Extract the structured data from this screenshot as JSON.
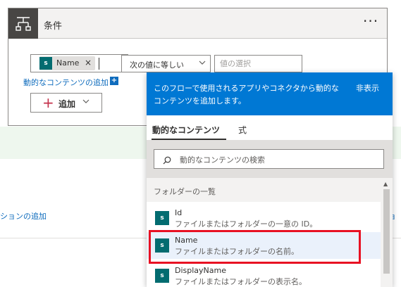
{
  "condition": {
    "title": "条件",
    "more": "···",
    "token": {
      "icon": "s",
      "label": "Name",
      "remove": "×"
    },
    "operator": {
      "label": "次の値に等しい"
    },
    "value": {
      "placeholder": "値の選択"
    },
    "dynamic_link": "動的なコンテンツの追加",
    "dynamic_plus": "+",
    "add_button": {
      "plus": "+",
      "label": "追加"
    }
  },
  "background": {
    "link_left": "ションの追加",
    "link_right": "ョ"
  },
  "panel": {
    "message": "このフローで使用されるアプリやコネクタから動的なコンテンツを追加します。",
    "hide": "非表示",
    "tabs": [
      {
        "label": "動的なコンテンツ"
      },
      {
        "label": "式"
      }
    ],
    "search_placeholder": "動的なコンテンツの検索",
    "section": "フォルダーの一覧",
    "items": [
      {
        "icon": "s",
        "title": "Id",
        "desc": "ファイルまたはフォルダーの一意の ID。"
      },
      {
        "icon": "s",
        "title": "Name",
        "desc": "ファイルまたはフォルダーの名前。"
      },
      {
        "icon": "s",
        "title": "DisplayName",
        "desc": "ファイルまたはフォルダーの表示名。"
      }
    ]
  },
  "colors": {
    "accent": "#0078d4",
    "highlight": "#e81123",
    "sharepoint": "#036c70",
    "link": "#0f6cbd"
  }
}
